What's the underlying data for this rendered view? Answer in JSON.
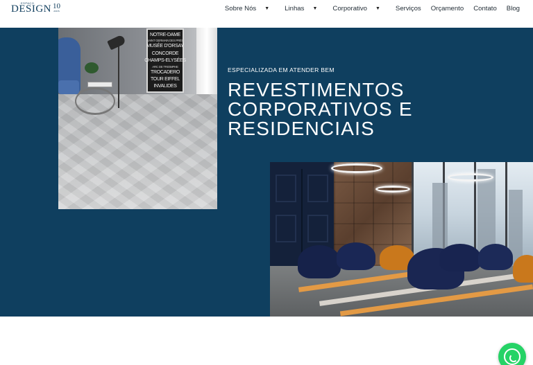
{
  "header": {
    "logo": {
      "word": "DESIGN",
      "pre": "ESPAÇO",
      "number": "10",
      "sub": "ANOS"
    },
    "nav": [
      {
        "label": "Sobre Nós",
        "has_dropdown": true,
        "icon": "caret-down-icon"
      },
      {
        "label": "Linhas",
        "has_dropdown": true,
        "icon": "caret-down-icon"
      },
      {
        "label": "Corporativo",
        "has_dropdown": true,
        "icon": "caret-down-icon"
      },
      {
        "label": "Serviços",
        "has_dropdown": false
      },
      {
        "label": "Orçamento",
        "has_dropdown": false
      },
      {
        "label": "Contato",
        "has_dropdown": false
      },
      {
        "label": "Blog",
        "has_dropdown": false
      }
    ],
    "caret_glyph": "▼"
  },
  "hero": {
    "background": "#0f3f5f",
    "eyebrow": "ESPECIALIZADA EM ATENDER BEM",
    "headline": [
      "REVESTIMENTOS",
      "CORPORATIVOS E",
      "RESIDENCIAIS"
    ],
    "poster_lines": [
      "NOTRE-DAME",
      "SAINT GERMAIN DES PRÉS",
      "MUSÉE D'ORSAY",
      "CONCORDE",
      "CHAMPS-ELYSÉES",
      "ARC DE TRIOMPHE",
      "TROCADERO",
      "TOUR EIFFEL",
      "INVALIDES"
    ]
  },
  "whatsapp": {
    "icon": "whatsapp-icon",
    "color": "#25d366"
  }
}
